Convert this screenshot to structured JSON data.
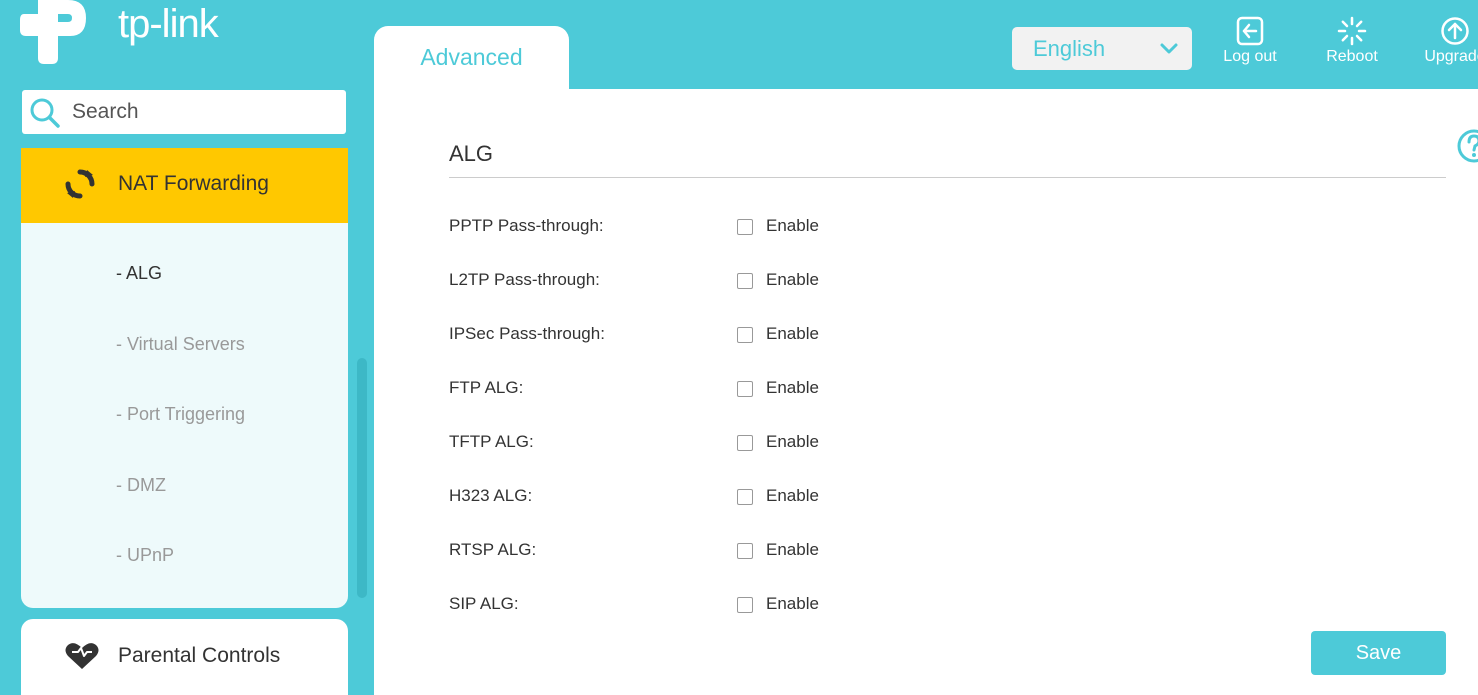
{
  "brand": {
    "name": "tp-link"
  },
  "tabs": [
    {
      "label": "Advanced",
      "active": true
    }
  ],
  "header": {
    "language": "English",
    "buttons": [
      {
        "label": "Log out",
        "icon": "logout-icon"
      },
      {
        "label": "Reboot",
        "icon": "reboot-icon"
      },
      {
        "label": "Upgrade",
        "icon": "upgrade-icon"
      }
    ]
  },
  "sidebar": {
    "search": {
      "placeholder": "Search"
    },
    "sections": [
      {
        "label": "NAT Forwarding",
        "icon": "nat-forwarding-icon",
        "expanded": true,
        "items": [
          {
            "label": "- ALG",
            "active": true
          },
          {
            "label": "- Virtual Servers"
          },
          {
            "label": "- Port Triggering"
          },
          {
            "label": "- DMZ"
          },
          {
            "label": "- UPnP"
          }
        ]
      },
      {
        "label": "Parental Controls",
        "icon": "heart-icon"
      }
    ]
  },
  "main": {
    "title": "ALG",
    "rows": [
      {
        "label": "PPTP Pass-through:",
        "option": "Enable",
        "checked": false
      },
      {
        "label": "L2TP Pass-through:",
        "option": "Enable",
        "checked": false
      },
      {
        "label": "IPSec Pass-through:",
        "option": "Enable",
        "checked": false
      },
      {
        "label": "FTP ALG:",
        "option": "Enable",
        "checked": false
      },
      {
        "label": "TFTP ALG:",
        "option": "Enable",
        "checked": false
      },
      {
        "label": "H323 ALG:",
        "option": "Enable",
        "checked": false
      },
      {
        "label": "RTSP ALG:",
        "option": "Enable",
        "checked": false
      },
      {
        "label": "SIP ALG:",
        "option": "Enable",
        "checked": false
      }
    ],
    "save_label": "Save"
  },
  "colors": {
    "accent": "#4dcad8",
    "active_nav": "#ffc800"
  }
}
